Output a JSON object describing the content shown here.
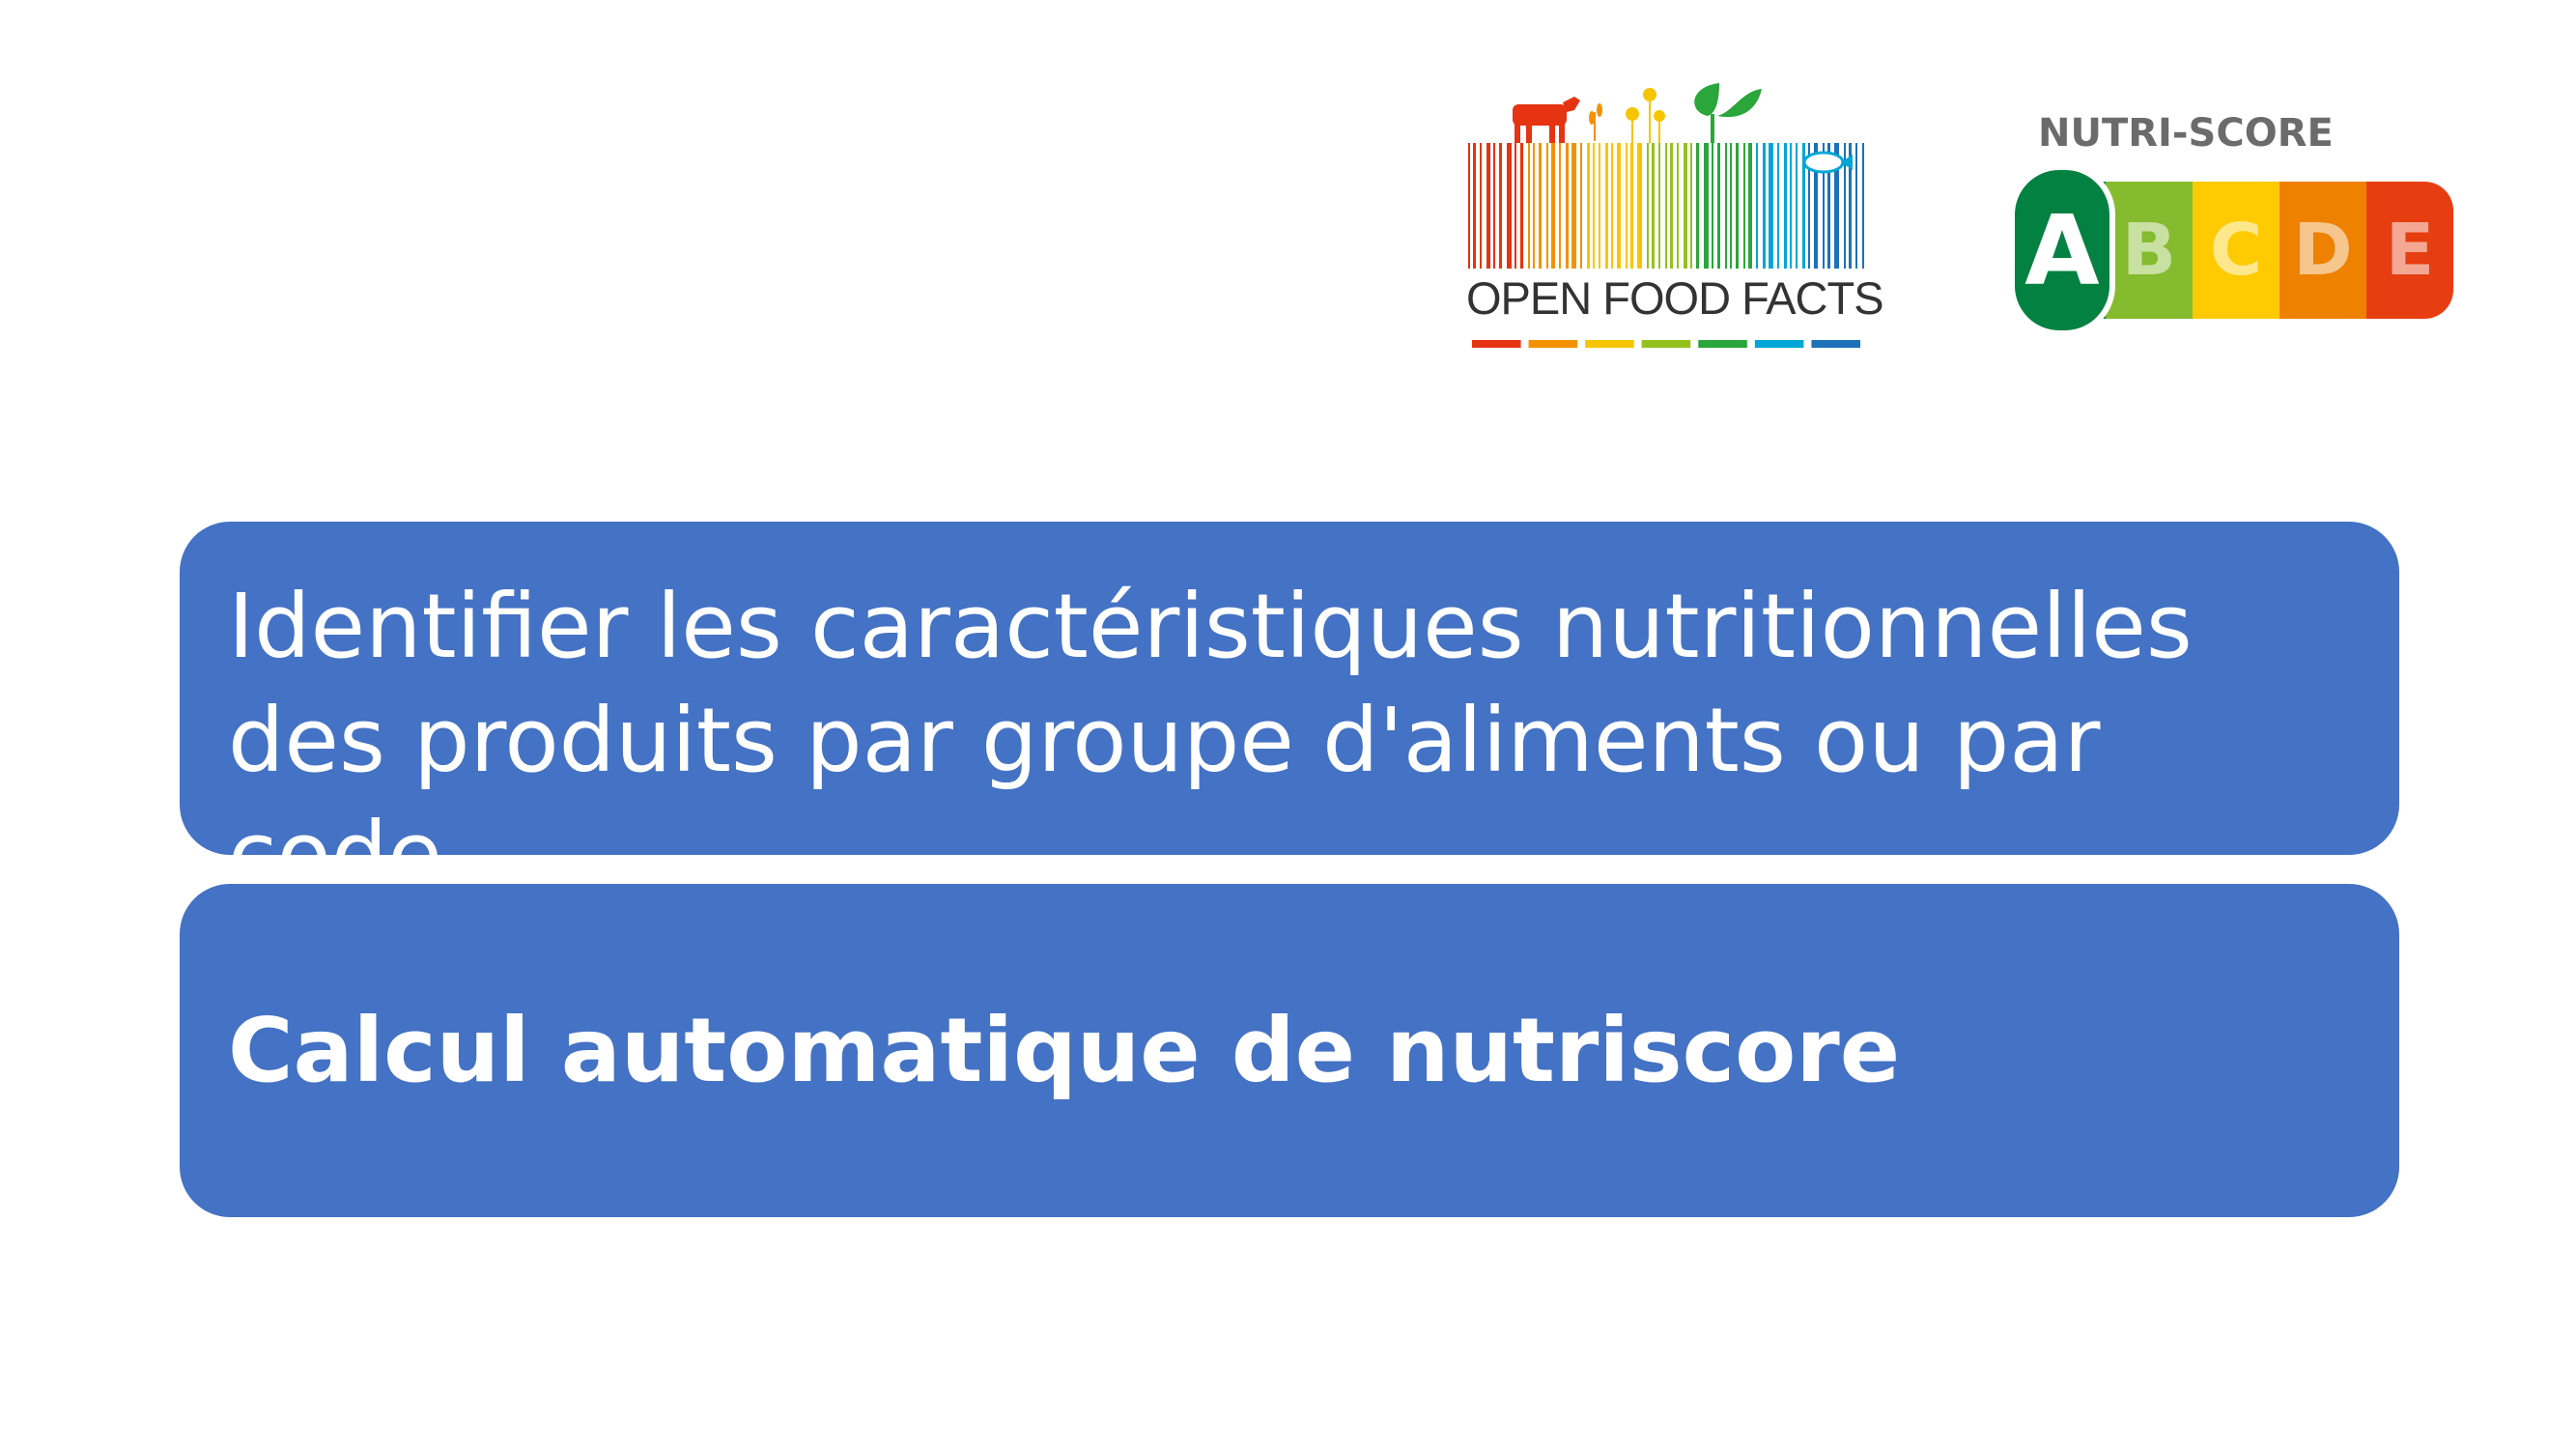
{
  "logos": {
    "open_food_facts": {
      "text": "OPEN FOOD FACTS",
      "colors": [
        "#e63312",
        "#f39200",
        "#f7c500",
        "#95c11f",
        "#2aa63a",
        "#00a6d6",
        "#1d71b8"
      ]
    },
    "nutri_score": {
      "title": "NUTRI-SCORE",
      "grades": [
        {
          "letter": "A",
          "color": "#038141"
        },
        {
          "letter": "B",
          "color": "#85bb2f"
        },
        {
          "letter": "C",
          "color": "#fecb02"
        },
        {
          "letter": "D",
          "color": "#ee8100"
        },
        {
          "letter": "E",
          "color": "#e63e11"
        }
      ],
      "selected": "A"
    }
  },
  "boxes": [
    {
      "text": "Identifier les caractéristiques nutritionnelles des produits par groupe d'aliments ou par code."
    },
    {
      "text": "Calcul automatique de nutriscore"
    }
  ],
  "colors": {
    "box_background": "#4472c4",
    "box_text": "#ffffff"
  }
}
